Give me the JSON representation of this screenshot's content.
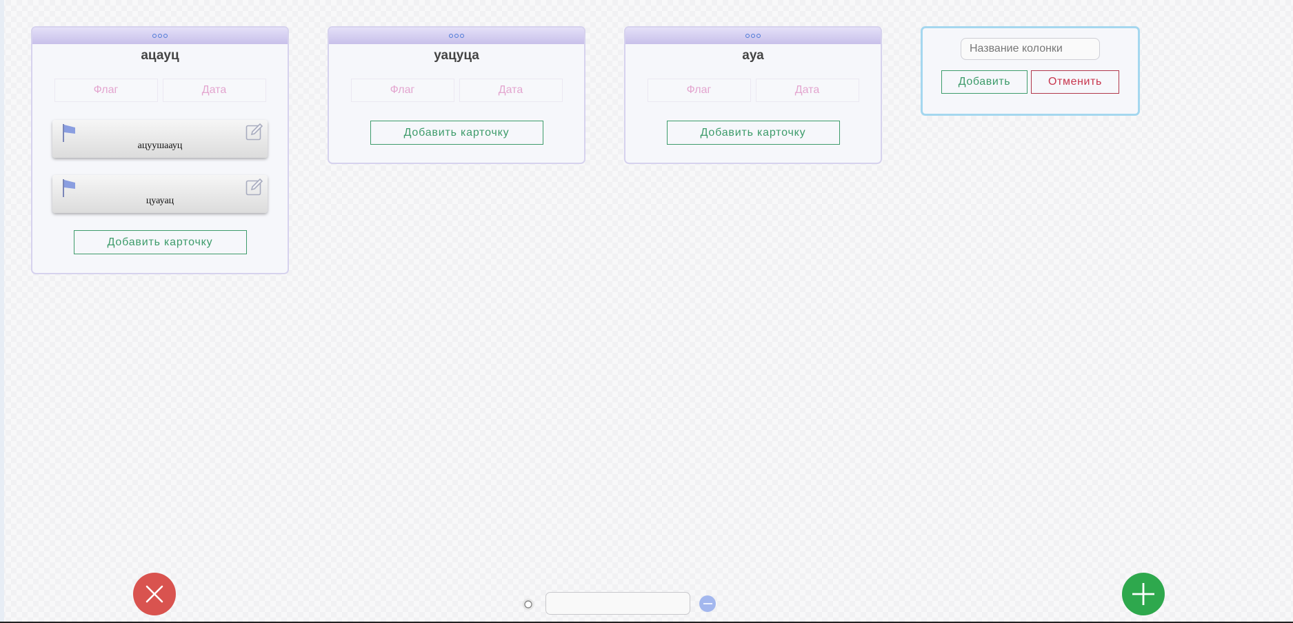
{
  "columns": [
    {
      "title": "ацауц",
      "filter_flag": "Флаг",
      "filter_date": "Дата",
      "cards": [
        {
          "text": "ацуушаауц"
        },
        {
          "text": "цуауац"
        }
      ],
      "add_card_label": "Добавить карточку"
    },
    {
      "title": "уацуца",
      "filter_flag": "Флаг",
      "filter_date": "Дата",
      "cards": [],
      "add_card_label": "Добавить карточку"
    },
    {
      "title": "ауа",
      "filter_flag": "Флаг",
      "filter_date": "Дата",
      "cards": [],
      "add_card_label": "Добавить карточку"
    }
  ],
  "new_column": {
    "placeholder": "Название колонки",
    "value": "",
    "add_label": "Добавить",
    "cancel_label": "Отменить"
  },
  "icons": {
    "column_handle": "drag-dots-icon",
    "card_flag": "flag-icon",
    "card_edit": "edit-icon",
    "fab_close": "close-icon",
    "fab_add": "plus-icon",
    "zoom_left": "sun-icon",
    "zoom_right": "minus-icon"
  },
  "colors": {
    "accent_green": "#3c9b6a",
    "cancel_red": "#c8354d",
    "fab_red": "#d9534f",
    "fab_green": "#2ea84d",
    "column_header": "#c8c0ea",
    "flag_blue": "#8a9ee0",
    "filter_pink": "#e3a5cf"
  }
}
